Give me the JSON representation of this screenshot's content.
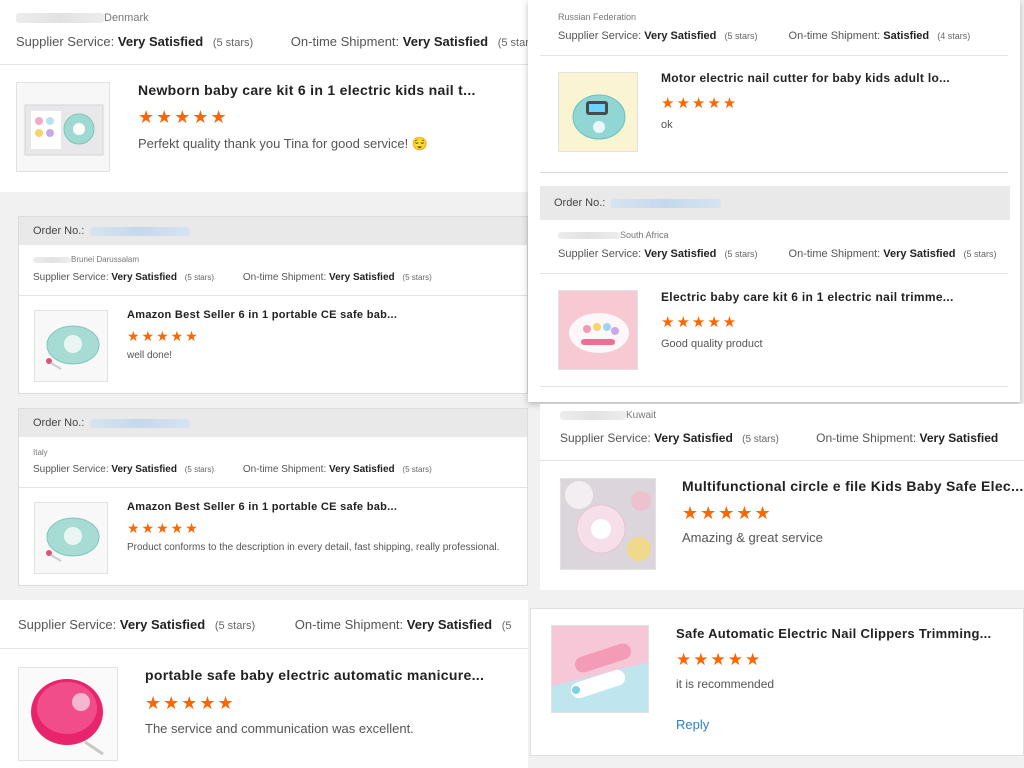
{
  "stars": "★★★★★",
  "order_label": "Order No.:",
  "reviews": [
    {
      "country": "Denmark",
      "supplier_label": "Supplier Service:",
      "supplier_value": "Very Satisfied",
      "supplier_stars": "(5 stars)",
      "shipment_label": "On-time Shipment:",
      "shipment_value": "Very Satisfied",
      "shipment_stars": "(5 stars)",
      "product_title": "Newborn baby care kit 6 in 1 electric kids nail t...",
      "comment": "Perfekt quality thank you Tina for good service! 😌"
    },
    {
      "country": "Brunei Darussalam",
      "supplier_label": "Supplier Service:",
      "supplier_value": "Very Satisfied",
      "supplier_stars": "(5 stars)",
      "shipment_label": "On-time Shipment:",
      "shipment_value": "Very Satisfied",
      "shipment_stars": "(5 stars)",
      "product_title": "Amazon Best Seller 6 in 1 portable CE safe bab...",
      "comment": "well done!"
    },
    {
      "country": "Italy",
      "supplier_label": "Supplier Service:",
      "supplier_value": "Very Satisfied",
      "supplier_stars": "(5 stars)",
      "shipment_label": "On-time Shipment:",
      "shipment_value": "Very Satisfied",
      "shipment_stars": "(5 stars)",
      "product_title": "Amazon Best Seller 6 in 1 portable CE safe bab...",
      "comment": "Product conforms to the description in every detail, fast shipping, really professional."
    },
    {
      "supplier_label": "Supplier Service:",
      "supplier_value": "Very Satisfied",
      "supplier_stars": "(5 stars)",
      "shipment_label": "On-time Shipment:",
      "shipment_value": "Very Satisfied",
      "shipment_stars": "(5",
      "product_title": "portable safe baby electric automatic manicure...",
      "comment": "The service and communication was excellent."
    },
    {
      "country": "Russian Federation",
      "supplier_label": "Supplier Service:",
      "supplier_value": "Very Satisfied",
      "supplier_stars": "(5 stars)",
      "shipment_label": "On-time Shipment:",
      "shipment_value": "Satisfied",
      "shipment_stars": "(4 stars)",
      "product_title": "Motor electric nail cutter for baby kids adult lo...",
      "comment": "ok"
    },
    {
      "country": "South Africa",
      "supplier_label": "Supplier Service:",
      "supplier_value": "Very Satisfied",
      "supplier_stars": "(5 stars)",
      "shipment_label": "On-time Shipment:",
      "shipment_value": "Very Satisfied",
      "shipment_stars": "(5 stars)",
      "product_title": "Electric baby care kit 6 in 1 electric nail trimme...",
      "comment": "Good quality product"
    },
    {
      "country": "Kuwait",
      "supplier_label": "Supplier Service:",
      "supplier_value": "Very Satisfied",
      "supplier_stars": "(5 stars)",
      "shipment_label": "On-time Shipment:",
      "shipment_value": "Very Satisfied",
      "product_title": "Multifunctional circle e file Kids Baby Safe Elec...",
      "comment": "Amazing & great service"
    },
    {
      "product_title": "Safe Automatic Electric Nail Clippers Trimming...",
      "comment": "it is recommended",
      "reply": "Reply"
    }
  ]
}
